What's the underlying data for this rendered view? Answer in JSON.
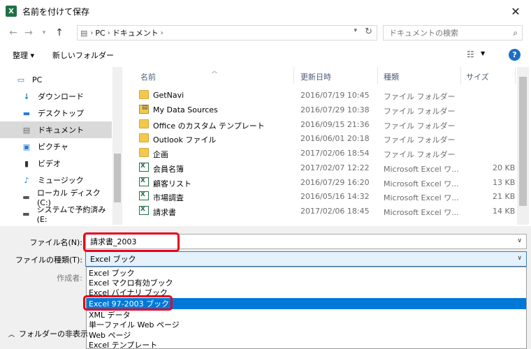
{
  "window": {
    "title": "名前を付けて保存",
    "app_icon": "excel-icon",
    "close": "✕"
  },
  "address": {
    "crumbs": [
      "PC",
      "ドキュメント"
    ],
    "search_placeholder": "ドキュメントの検索"
  },
  "commands": {
    "organize": "整理 ▾",
    "new_folder": "新しいフォルダー",
    "help": "?"
  },
  "nav": {
    "items": [
      {
        "label": "PC"
      },
      {
        "label": "ダウンロード"
      },
      {
        "label": "デスクトップ"
      },
      {
        "label": "ドキュメント"
      },
      {
        "label": "ピクチャ"
      },
      {
        "label": "ビデオ"
      },
      {
        "label": "ミュージック"
      },
      {
        "label": "ローカル ディスク (C:)"
      },
      {
        "label": "システムで予約済み (E:"
      }
    ]
  },
  "files": {
    "headers": {
      "name": "名前",
      "date": "更新日時",
      "type": "種類",
      "size": "サイズ"
    },
    "rows": [
      {
        "name": "GetNavi",
        "date": "2016/07/19 10:45",
        "type": "ファイル フォルダー",
        "size": "",
        "icon": "folder"
      },
      {
        "name": "My Data Sources",
        "date": "2016/07/29 10:38",
        "type": "ファイル フォルダー",
        "size": "",
        "icon": "db"
      },
      {
        "name": "Office のカスタム テンプレート",
        "date": "2016/09/15 21:36",
        "type": "ファイル フォルダー",
        "size": "",
        "icon": "folder"
      },
      {
        "name": "Outlook ファイル",
        "date": "2016/06/01 20:18",
        "type": "ファイル フォルダー",
        "size": "",
        "icon": "folder"
      },
      {
        "name": "企画",
        "date": "2017/02/06 18:54",
        "type": "ファイル フォルダー",
        "size": "",
        "icon": "folder"
      },
      {
        "name": "会員名簿",
        "date": "2017/02/07 12:22",
        "type": "Microsoft Excel ワ...",
        "size": "20 KB",
        "icon": "xls"
      },
      {
        "name": "顧客リスト",
        "date": "2016/07/29 16:20",
        "type": "Microsoft Excel ワ...",
        "size": "13 KB",
        "icon": "xls"
      },
      {
        "name": "市場調査",
        "date": "2016/05/16 14:32",
        "type": "Microsoft Excel ワ...",
        "size": "21 KB",
        "icon": "xls"
      },
      {
        "name": "請求書",
        "date": "2017/02/06 18:45",
        "type": "Microsoft Excel ワ...",
        "size": "14 KB",
        "icon": "xls"
      }
    ]
  },
  "form": {
    "filename_label": "ファイル名(N):",
    "filename_value": "請求書_2003",
    "filetype_label": "ファイルの種類(T):",
    "filetype_value": "Excel ブック",
    "author_label": "作成者:",
    "options": [
      "Excel ブック",
      "Excel マクロ有効ブック",
      "Excel バイナリ ブック",
      "Excel 97-2003 ブック",
      "XML データ",
      "単一ファイル Web ページ",
      "Web ページ",
      "Excel テンプレート"
    ],
    "highlighted_option_index": 3,
    "hide_folders": "フォルダーの非表示"
  },
  "colors": {
    "highlight": "#0078d7",
    "callout": "#e8001c",
    "excel": "#1e7145"
  }
}
